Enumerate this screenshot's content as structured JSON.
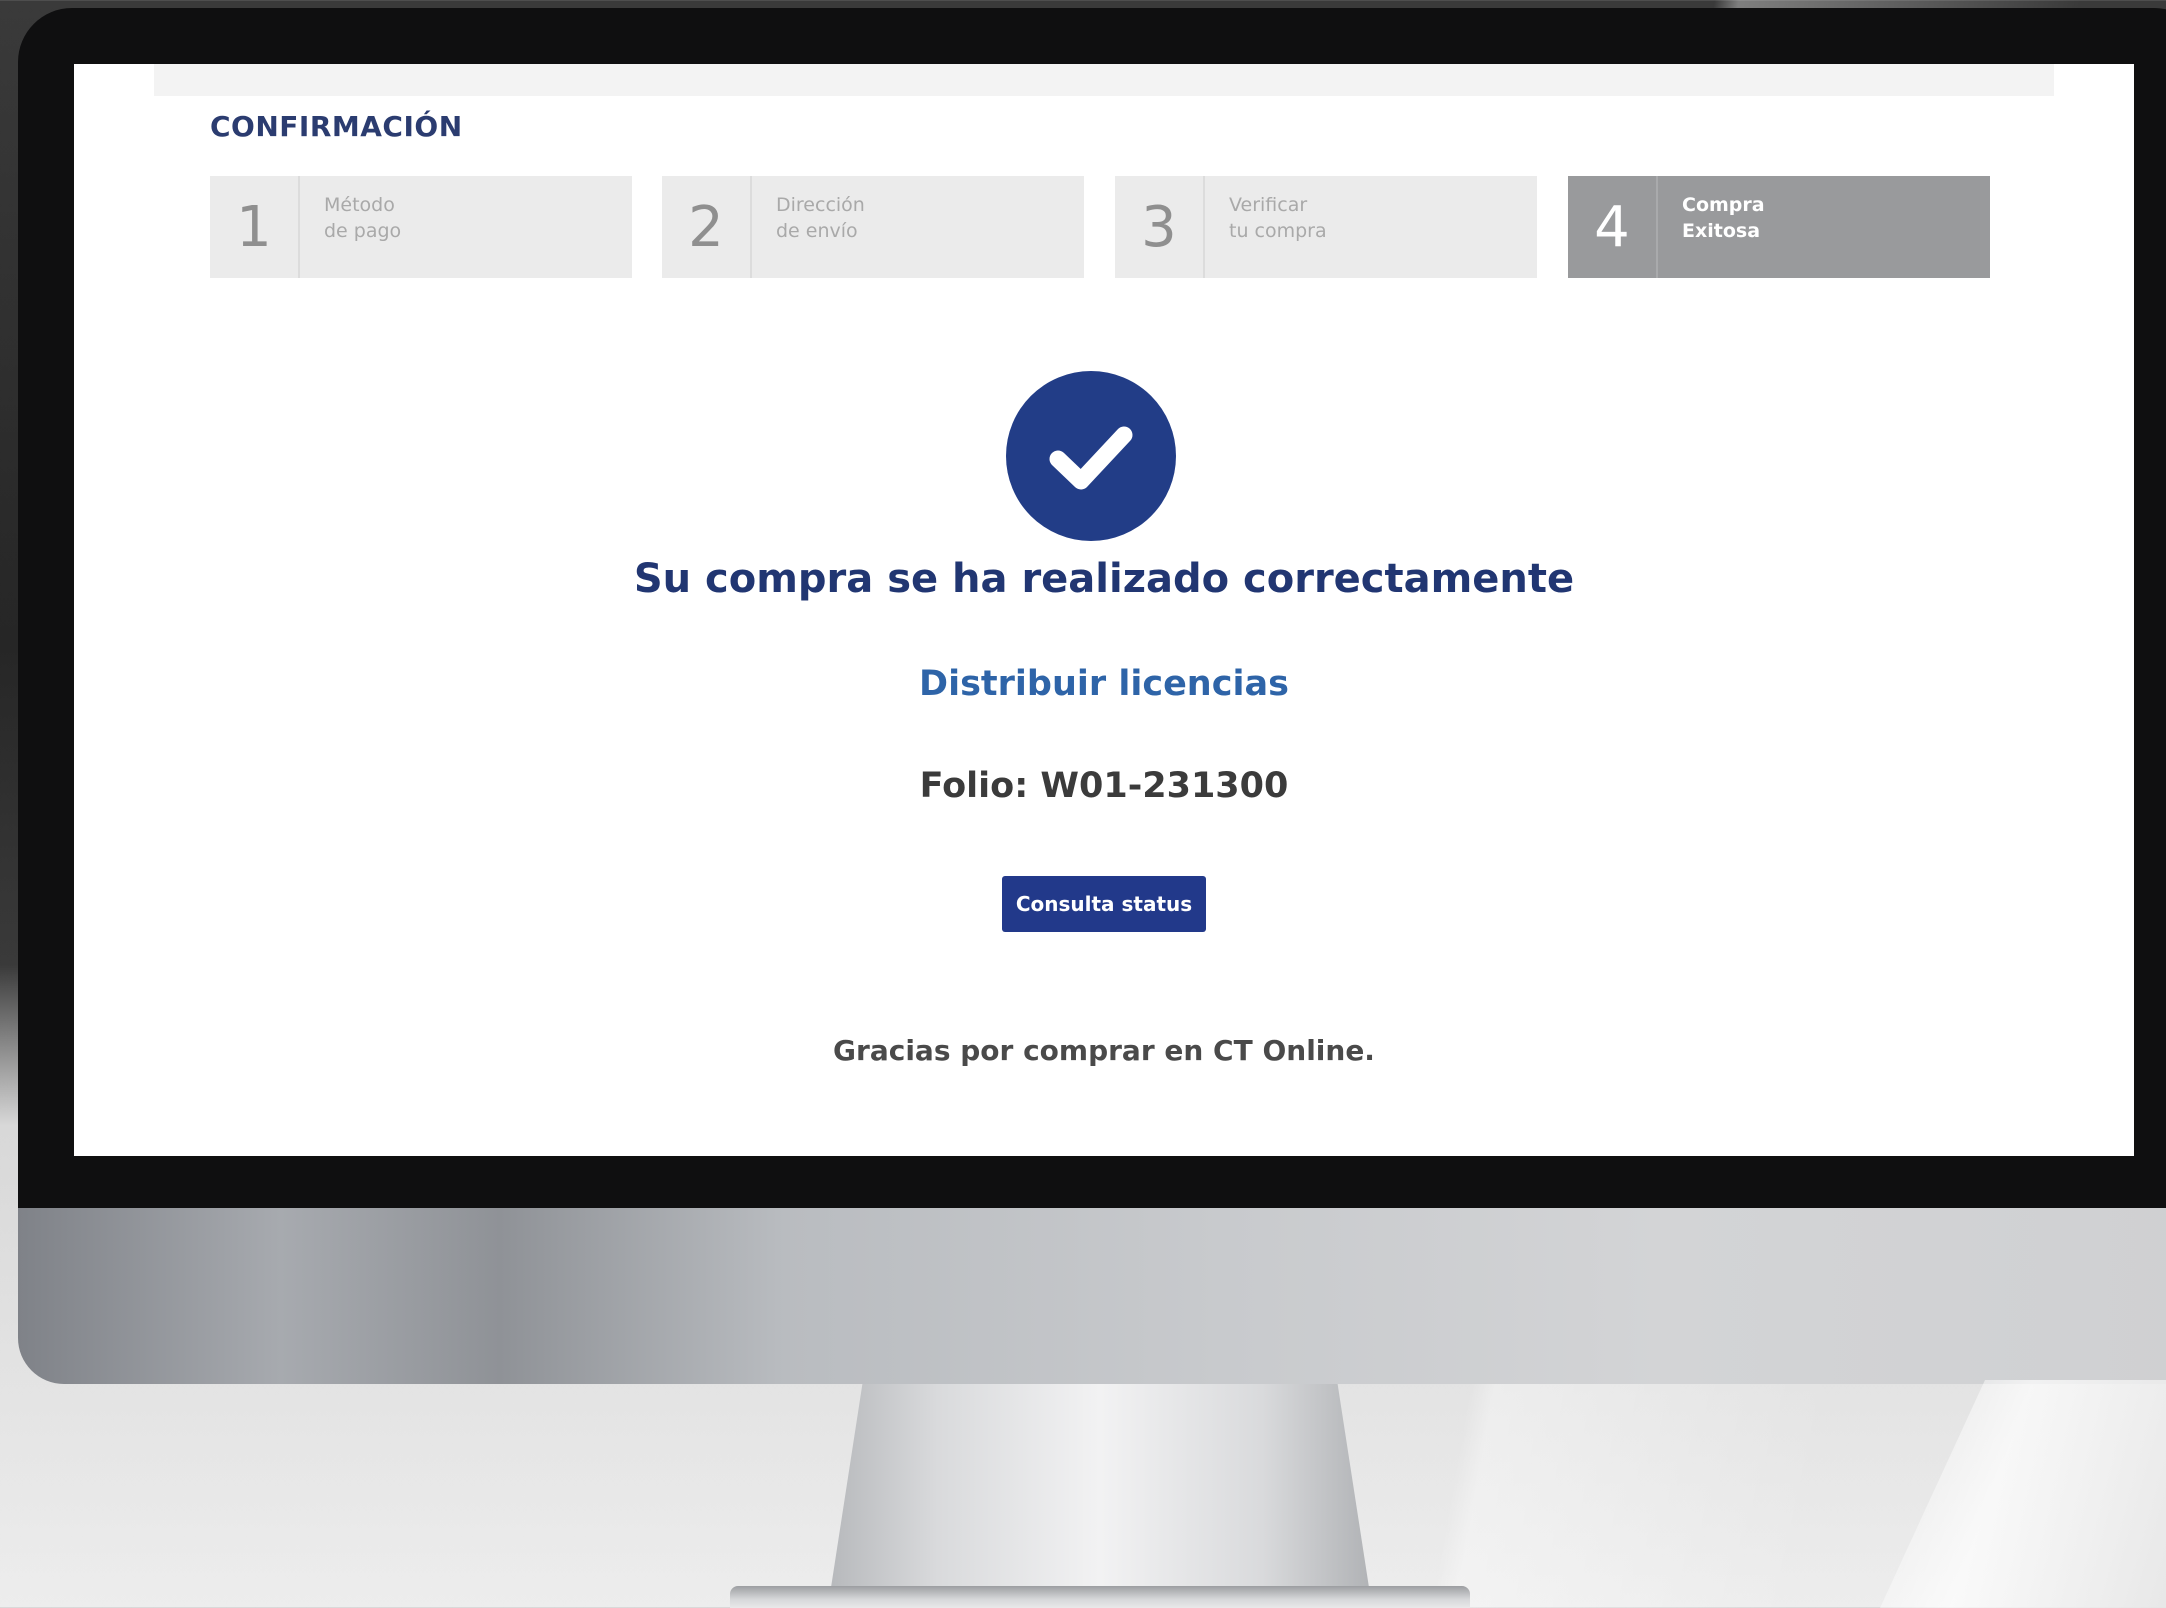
{
  "page": {
    "section_title": "CONFIRMACIÓN"
  },
  "steps": [
    {
      "number": "1",
      "line1": "Método",
      "line2": "de pago",
      "active": false
    },
    {
      "number": "2",
      "line1": "Dirección",
      "line2": "de envío",
      "active": false
    },
    {
      "number": "3",
      "line1": "Verificar",
      "line2": "tu compra",
      "active": false
    },
    {
      "number": "4",
      "line1": "Compra",
      "line2": "Exitosa",
      "active": true
    }
  ],
  "confirmation": {
    "icon": "check-circle-icon",
    "title": "Su compra se ha realizado correctamente",
    "distribute_link": "Distribuir licencias",
    "folio": "Folio: W01-231300",
    "status_button": "Consulta status",
    "thanks": "Gracias por comprar en CT Online."
  },
  "colors": {
    "primary": "#223d87",
    "link": "#2e64a8",
    "step_inactive": "#ebebeb",
    "step_active": "#999a9c"
  }
}
